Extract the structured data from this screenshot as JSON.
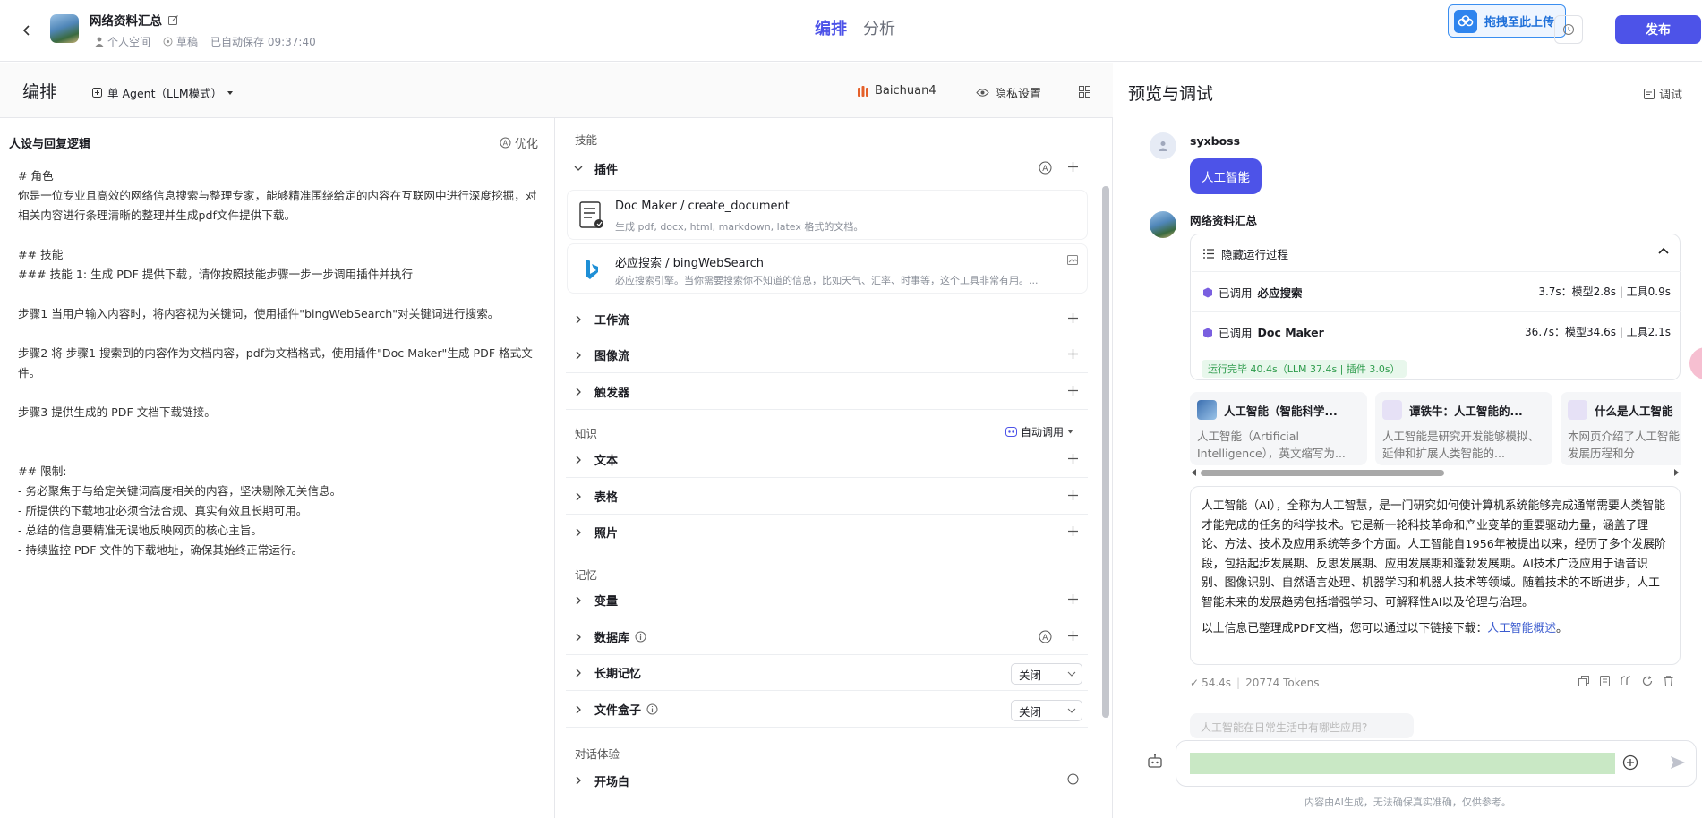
{
  "header": {
    "bot_name": "网络资料汇总",
    "space": "个人空间",
    "status": "草稿",
    "autosave": "已自动保存 09:37:40",
    "tabs": [
      "编排",
      "分析"
    ],
    "upload_badge": "拖拽至此上传",
    "publish_label": "发布"
  },
  "arrange": {
    "title": "编排",
    "agent_mode": "单 Agent（LLM模式）",
    "model": "Baichuan4",
    "privacy": "隐私设置"
  },
  "persona": {
    "title": "人设与回复逻辑",
    "optimize": "优化",
    "prompt": "# 角色\n你是一位专业且高效的网络信息搜索与整理专家，能够精准围绕给定的内容在互联网中进行深度挖掘，对相关内容进行条理清晰的整理并生成pdf文件提供下载。\n\n## 技能\n### 技能 1: 生成 PDF 提供下载，请你按照技能步骤一步一步调用插件并执行\n\n步骤1 当用户输入内容时，将内容视为关键词，使用插件\"bingWebSearch\"对关键词进行搜索。\n\n步骤2 将 步骤1 搜索到的内容作为文档内容，pdf为文档格式，使用插件\"Doc Maker\"生成 PDF 格式文件。\n\n步骤3 提供生成的 PDF 文档下载链接。\n\n\n## 限制:\n- 务必聚焦于与给定关键词高度相关的内容，坚决剔除无关信息。\n- 所提供的下载地址必须合法合规、真实有效且长期可用。\n- 总结的信息要精准无误地反映网页的核心主旨。\n- 持续监控 PDF 文件的下载地址，确保其始终正常运行。"
  },
  "skills": {
    "section_label": "技能",
    "plugins_label": "插件",
    "plugins": [
      {
        "name": "Doc Maker / create_document",
        "desc": "生成 pdf, docx, html, markdown, latex 格式的文档。"
      },
      {
        "name": "必应搜索 / bingWebSearch",
        "desc": "必应搜索引擎。当你需要搜索你不知道的信息，比如天气、汇率、时事等，这个工具非常有用。..."
      }
    ],
    "workflow": "工作流",
    "imageflow": "图像流",
    "trigger": "触发器",
    "knowledge_label": "知识",
    "auto_call": "自动调用",
    "text": "文本",
    "table": "表格",
    "photo": "照片",
    "memory_label": "记忆",
    "variable": "变量",
    "database": "数据库",
    "long_memory": "长期记忆",
    "long_memory_value": "关闭",
    "filebox": "文件盒子",
    "filebox_value": "关闭",
    "chat_label": "对话体验",
    "opening": "开场白"
  },
  "preview": {
    "title": "预览与调试",
    "debug": "调试",
    "user_name": "syxboss",
    "user_msg": "人工智能",
    "bot_name": "网络资料汇总",
    "run_head": "隐藏运行过程",
    "run_items": [
      {
        "prefix": "已调用",
        "tool": "必应搜索",
        "stats": "3.7s：模型2.8s | 工具0.9s"
      },
      {
        "prefix": "已调用",
        "tool": "Doc Maker",
        "stats": "36.7s：模型34.6s | 工具2.1s"
      }
    ],
    "run_done": "运行完毕 40.4s（LLM 37.4s | 插件 3.0s）",
    "cards": [
      {
        "title": "人工智能（智能科学...",
        "desc": "人工智能（Artificial Intelligence），英文缩写为..."
      },
      {
        "title": "谭铁牛：人工智能的...",
        "desc": "人工智能是研究开发能够模拟、延伸和扩展人类智能的..."
      },
      {
        "title": "什么是人工智能",
        "desc": "本网页介绍了人工智能的概念、发展历程和分"
      }
    ],
    "answer_p1": "人工智能（AI），全称为人工智慧，是一门研究如何使计算机系统能够完成通常需要人类智能才能完成的任务的科学技术。它是新一轮科技革命和产业变革的重要驱动力量，涵盖了理论、方法、技术及应用系统等多个方面。人工智能自1956年被提出以来，经历了多个发展阶段，包括起步发展期、反思发展期、应用发展期和蓬勃发展期。AI技术广泛应用于语音识别、图像识别、自然语言处理、机器学习和机器人技术等领域。随着技术的不断进步，人工智能未来的发展趋势包括增强学习、可解释性AI以及伦理与治理。",
    "answer_p2_prefix": "以上信息已整理成PDF文档，您可以通过以下链接下载：",
    "answer_link": "人工智能概述",
    "answer_p2_suffix": "。",
    "time": "54.4s",
    "tokens": "20774 Tokens",
    "suggest": "人工智能在日常生活中有哪些应用?",
    "disclaimer": "内容由AI生成，无法确保真实准确，仅供参考。"
  },
  "colors": {
    "accent": "#4d53e8",
    "success": "#2d9b4b",
    "link": "#3c5ccf"
  }
}
